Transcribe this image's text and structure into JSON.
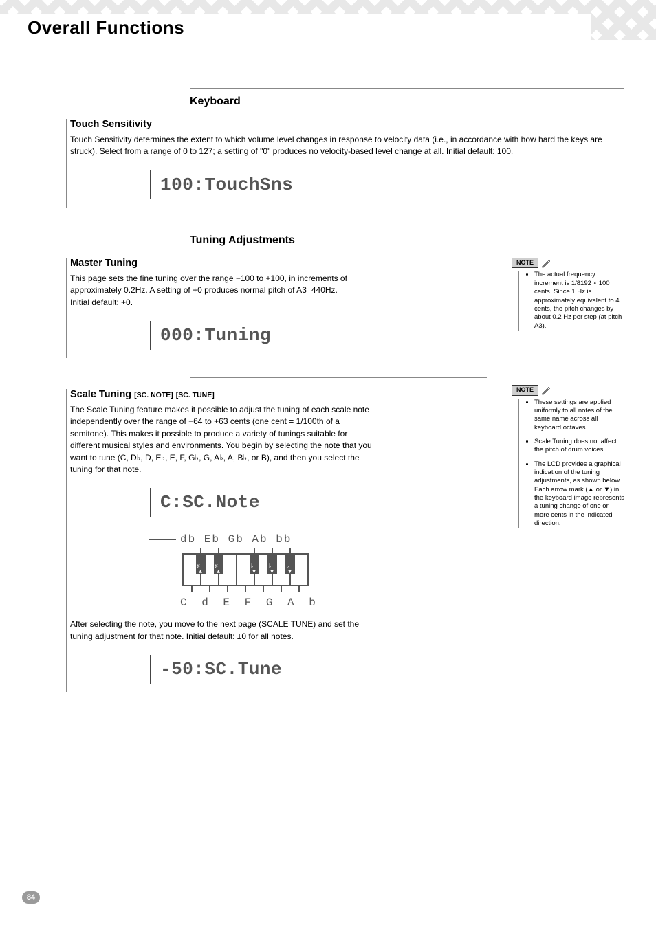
{
  "page_number": "84",
  "title": "Overall Functions",
  "sections": {
    "keyboard": {
      "heading": "Keyboard",
      "touch": {
        "title": "Touch Sensitivity",
        "tag_before": "",
        "tag_after": "",
        "body": "Touch Sensitivity determines the extent to which volume level changes in response to velocity data (i.e., in accordance with how hard the keys are struck). Select from a range of 0 to 127; a setting of \"0\" produces no velocity-based level change at all. Initial default: 100.",
        "lcd": "100:TouchSns"
      }
    },
    "tuning": {
      "heading": "Tuning Adjustments",
      "master": {
        "title": "Master Tuning",
        "tag_before": "",
        "tag_after": "",
        "body": "This page sets the fine tuning over the range −100 to +100, in increments of approximately 0.2Hz. A setting of +0 produces normal pitch of A3=440Hz. Initial default: +0.",
        "lcd": "000:Tuning",
        "note_items": [
          "The actual frequency increment is 1/8192 × 100 cents. Since 1 Hz is approximately equivalent to 4 cents, the pitch changes by about 0.2 Hz per step (at pitch A3)."
        ]
      },
      "scale": {
        "title": "Scale Tuning",
        "tag_before": "[SC. NOTE]",
        "tag_after": "[SC. TUNE]",
        "body_a": "The Scale Tuning feature makes it possible to adjust the tuning of each scale note independently over the range of −64 to +63 cents (one cent = 1/100th of a semitone). This makes it possible to produce a variety of tunings suitable for different musical styles and environments. You begin by selecting the note that you want to tune (C, D♭, D, E♭, E, F, G♭, G, A♭, A, B♭, or B), and then you select the tuning for that note.",
        "lcd_a": "C:SC.Note",
        "kbd_top": "db Eb Gb Ab bb",
        "kbd_bottom": "C d E F G A b",
        "body_b": "After selecting the note, you move to the next page (SCALE TUNE) and set the tuning adjustment for that note. Initial default: ±0 for all notes.",
        "lcd_b": "-50:SC.Tune",
        "note_items": [
          "These settings are applied uniformly to all notes of the same name across all keyboard octaves.",
          "Scale Tuning does not affect the pitch of drum voices.",
          "The LCD provides a graphical indication of the tuning adjustments, as shown below. Each arrow mark (▲ or ▼) in the keyboard image represents a tuning change of one or more cents in the indicated direction."
        ]
      }
    }
  }
}
